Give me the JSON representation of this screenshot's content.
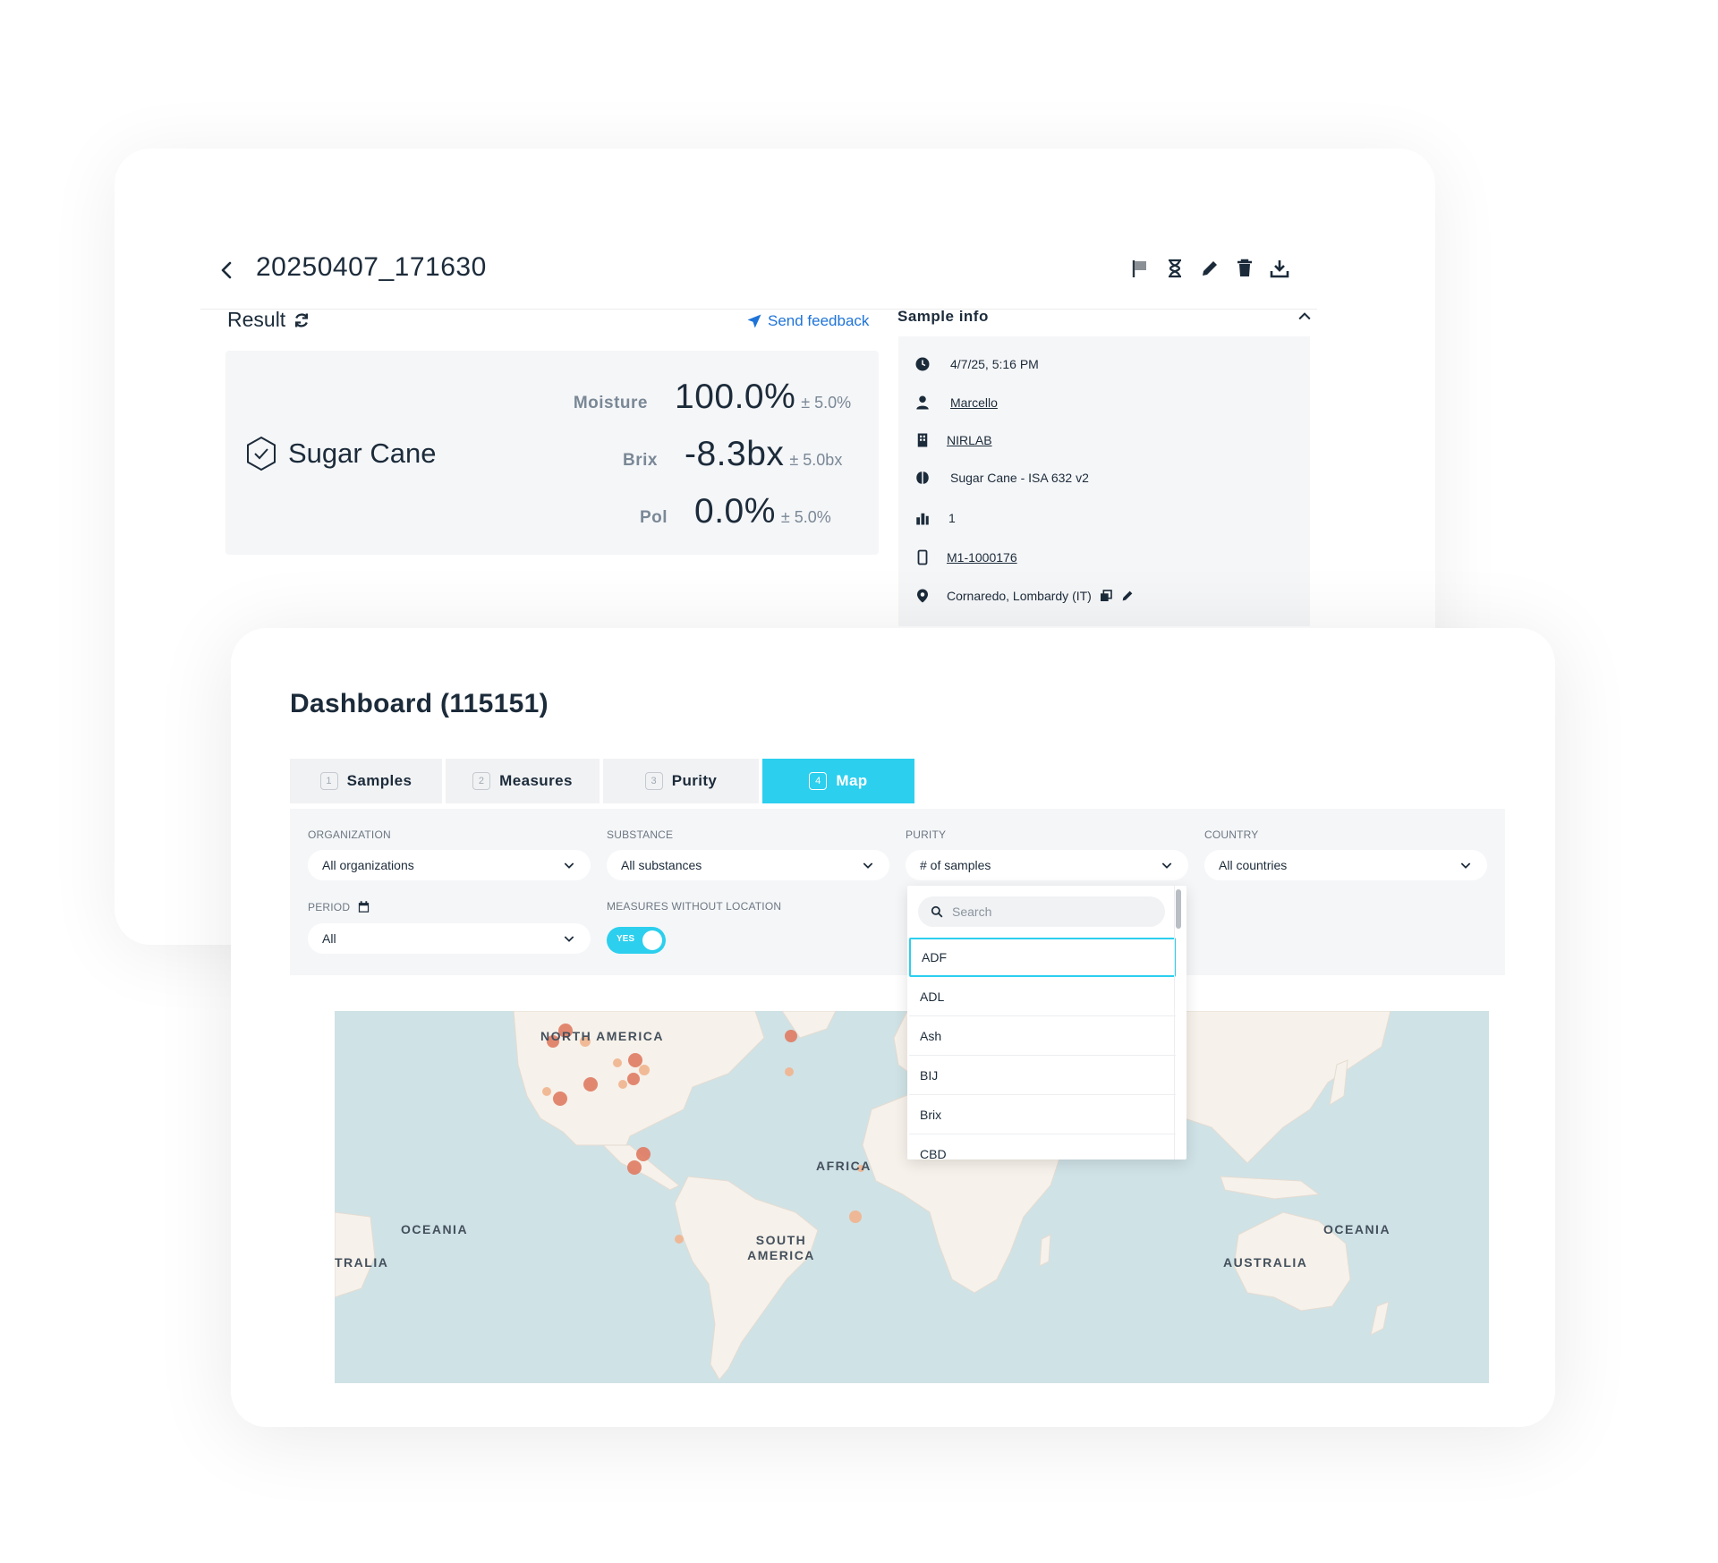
{
  "detail": {
    "sample_id": "20250407_171630",
    "result_label": "Result",
    "feedback_label": "Send feedback",
    "substance": "Sugar Cane",
    "measures": [
      {
        "label": "Moisture",
        "value": "100.0%",
        "tolerance": "± 5.0%"
      },
      {
        "label": "Brix",
        "value": "-8.3bx",
        "tolerance": "± 5.0bx"
      },
      {
        "label": "Pol",
        "value": "0.0%",
        "tolerance": "± 5.0%"
      }
    ],
    "sample_info": {
      "title": "Sample info",
      "datetime": "4/7/25, 5:16 PM",
      "user": "Marcello",
      "organization": "NIRLAB",
      "model": "Sugar Cane - ISA 632 v2",
      "count": "1",
      "device": "M1-1000176",
      "location": "Cornaredo, Lombardy (IT)"
    },
    "toolbar_icons": [
      "flag-icon",
      "hourglass-icon",
      "pencil-icon",
      "trash-icon",
      "download-icon"
    ]
  },
  "dashboard": {
    "title": "Dashboard (115151)",
    "tabs": [
      {
        "num": "1",
        "label": "Samples",
        "active": false
      },
      {
        "num": "2",
        "label": "Measures",
        "active": false
      },
      {
        "num": "3",
        "label": "Purity",
        "active": false
      },
      {
        "num": "4",
        "label": "Map",
        "active": true
      }
    ],
    "filters": {
      "organization": {
        "label": "ORGANIZATION",
        "value": "All organizations"
      },
      "substance": {
        "label": "SUBSTANCE",
        "value": "All substances"
      },
      "purity": {
        "label": "PURITY",
        "value": "# of samples"
      },
      "country": {
        "label": "COUNTRY",
        "value": "All countries"
      },
      "period": {
        "label": "PERIOD",
        "value": "All"
      },
      "measures_without_location": {
        "label": "MEASURES WITHOUT LOCATION",
        "toggle": "YES"
      }
    },
    "dropdown": {
      "search_placeholder": "Search",
      "options": [
        "ADF",
        "ADL",
        "Ash",
        "BIJ",
        "Brix",
        "CBD"
      ],
      "selected": "ADF"
    },
    "map_labels": {
      "north_america": "NORTH AMERICA",
      "south_america": "SOUTH AMERICA",
      "africa": "AFRICA",
      "oceania_left": "OCEANIA",
      "oceania_right": "OCEANIA",
      "australia_left": "TRALIA",
      "australia_right": "AUSTRALIA"
    }
  },
  "colors": {
    "accent": "#2ccfee",
    "link": "#1e73d8",
    "text": "#1c2b3a",
    "map_water": "#cfe2e6",
    "map_land": "#f6f1ea",
    "marker_dark": "#e07b62",
    "marker_light": "#f1b48e"
  }
}
